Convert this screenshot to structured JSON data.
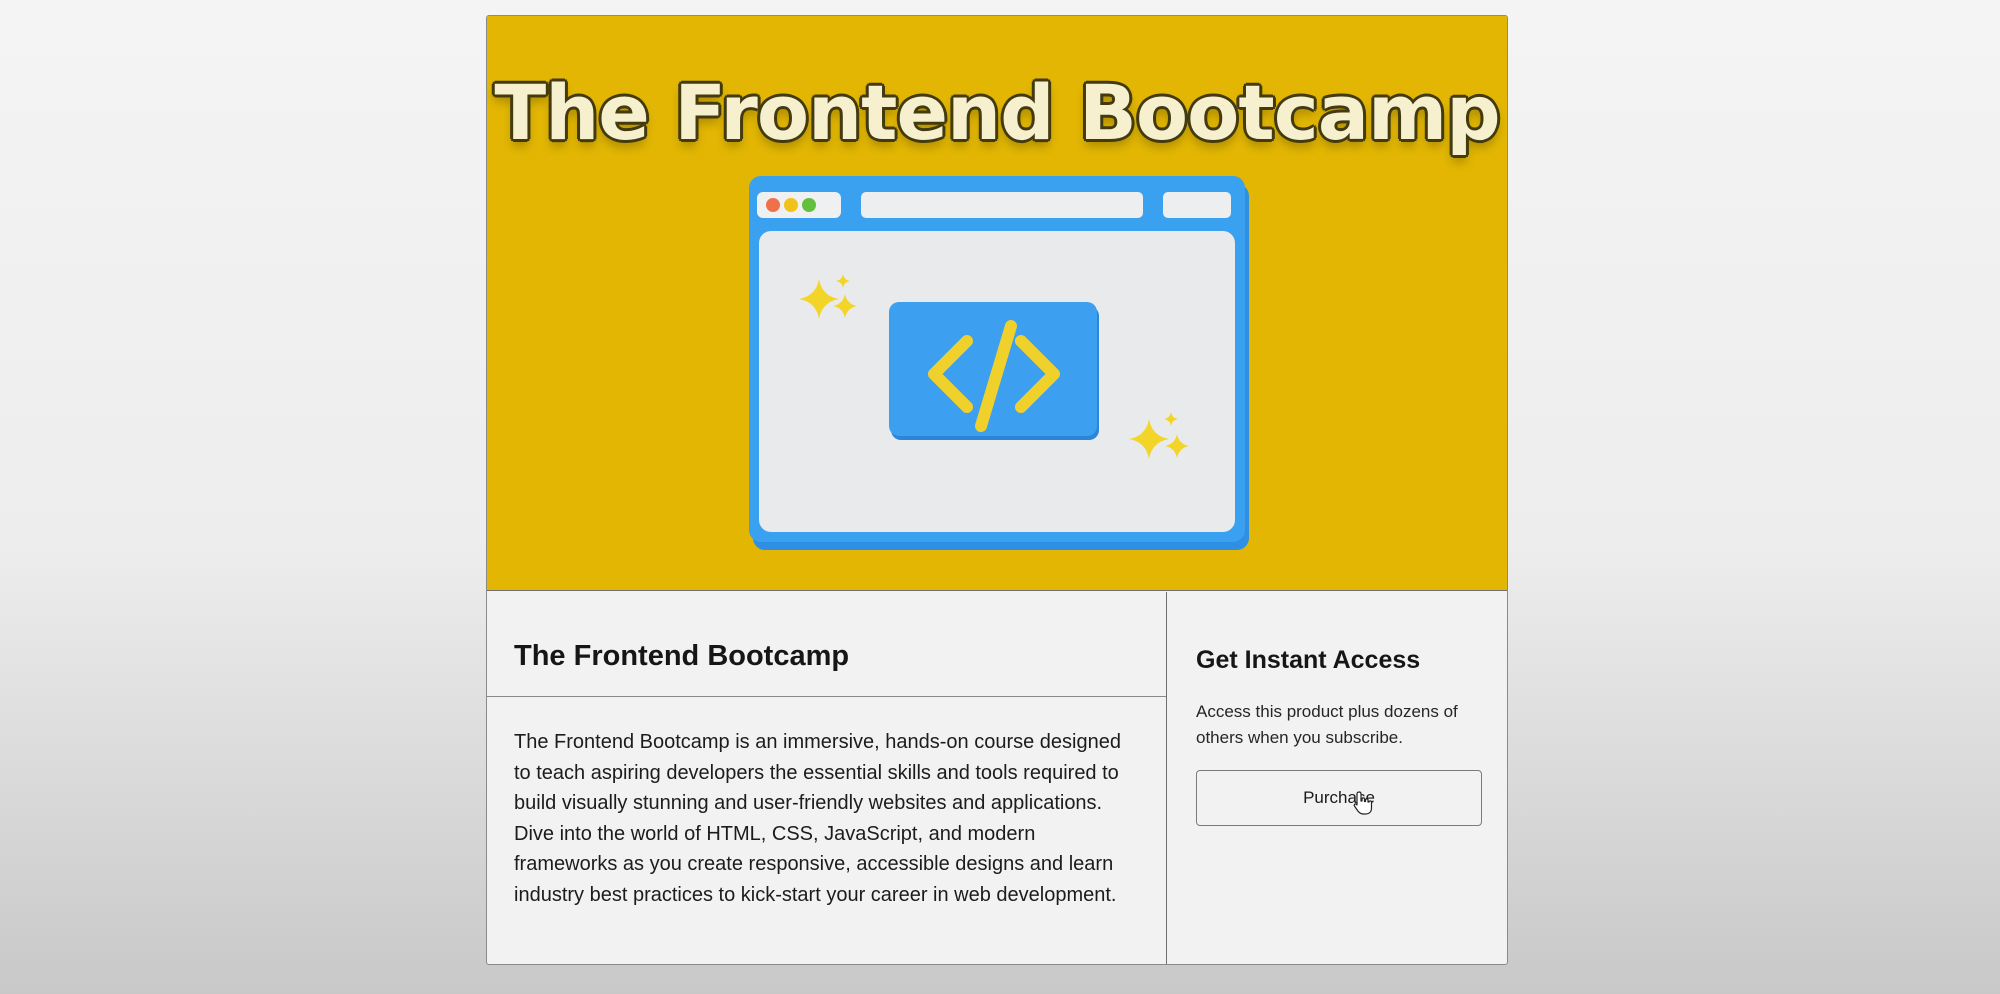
{
  "hero": {
    "title": "The Frontend Bootcamp",
    "illustration": {
      "window_dots": [
        "#f0704a",
        "#f2c21a",
        "#63c03e"
      ],
      "icon": "code-brackets-icon",
      "accent": "#3aa0f0",
      "sparkle_color": "#f3d52a"
    }
  },
  "product": {
    "title": "The Frontend Bootcamp",
    "description": "The Frontend Bootcamp is an immersive, hands-on course designed to teach aspiring developers the essential skills and tools required to build visually stunning and user-friendly websites and applications. Dive into the world of HTML, CSS, JavaScript, and modern frameworks as you create responsive, accessible designs and learn industry best practices to kick-start your career in web development."
  },
  "sidebar": {
    "title": "Get Instant Access",
    "description": "Access this product plus dozens of others when you subscribe.",
    "purchase_label": "Purchase"
  },
  "colors": {
    "hero_background": "#e2b603",
    "page_background": "#f2f2f2"
  }
}
